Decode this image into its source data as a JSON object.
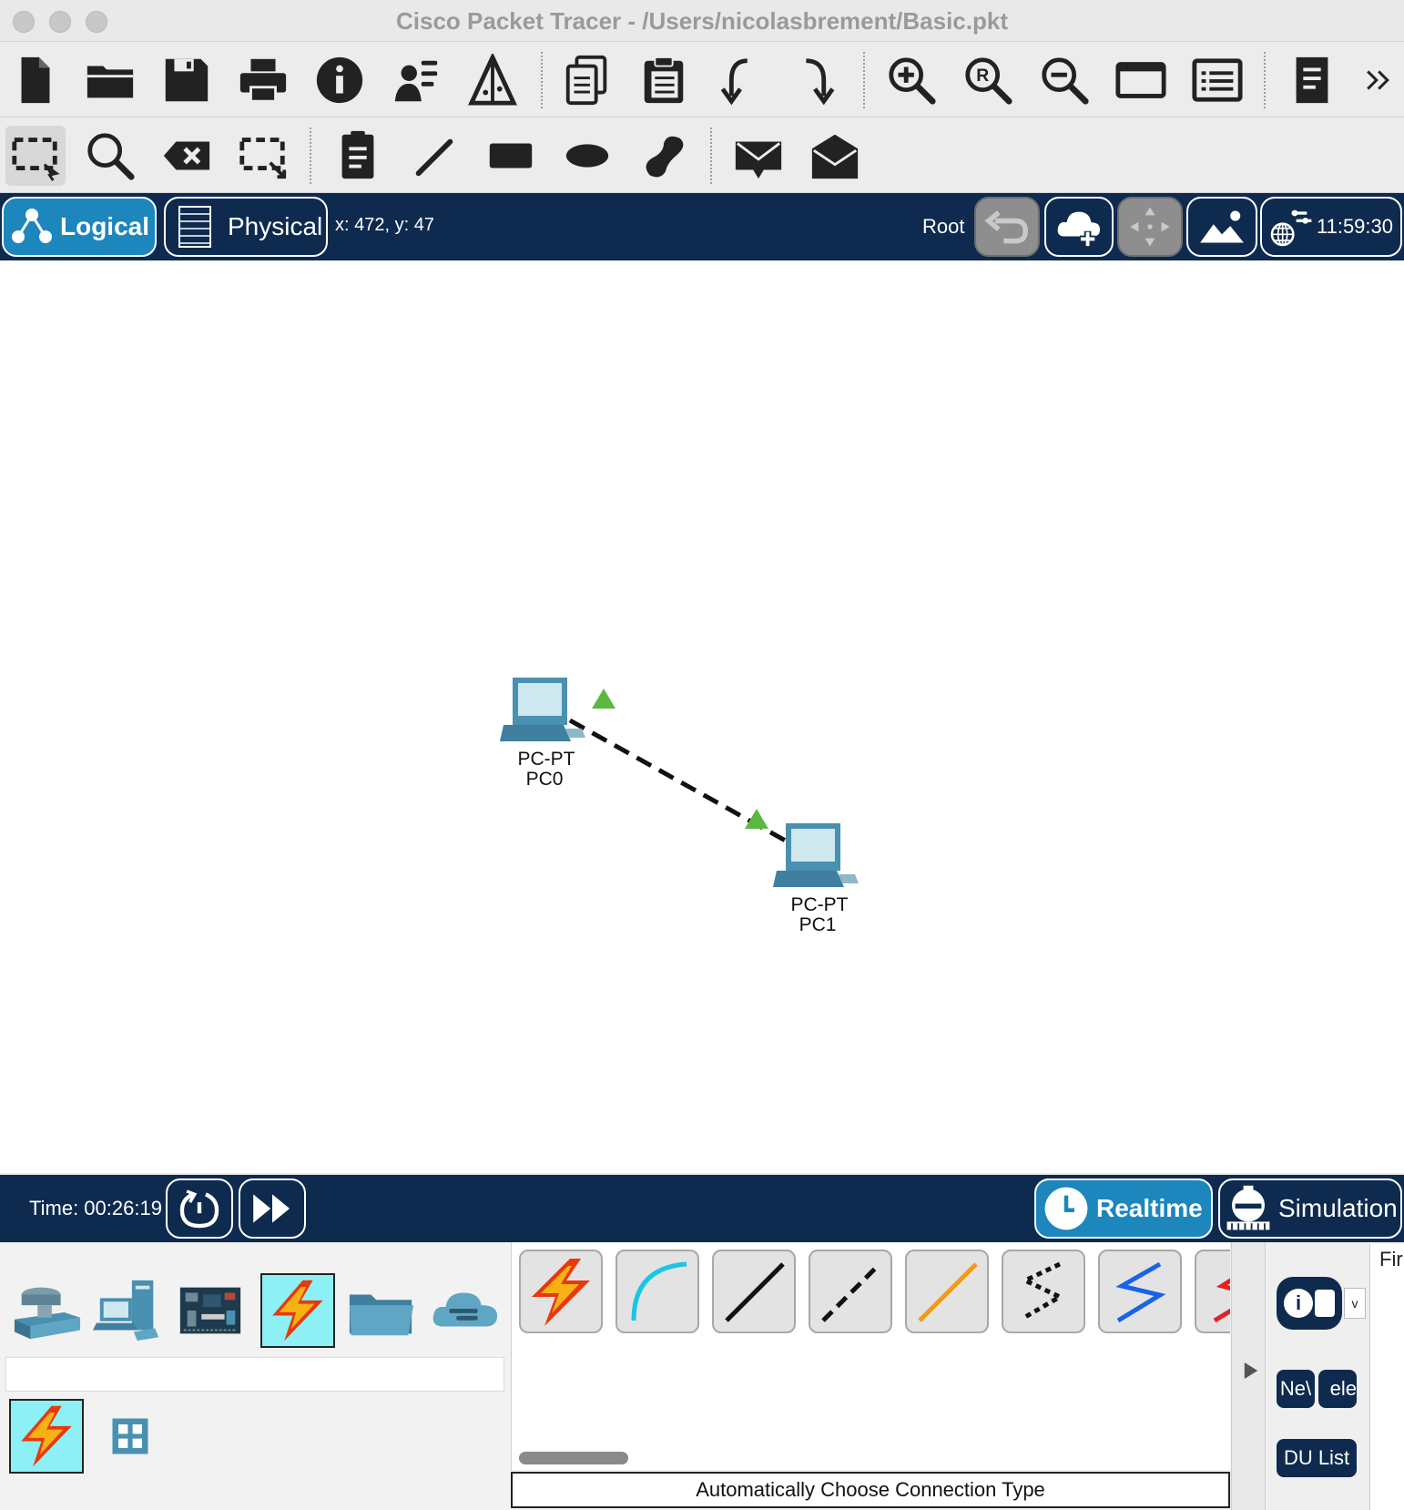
{
  "window": {
    "title": "Cisco Packet Tracer - /Users/nicolasbrement/Basic.pkt"
  },
  "main_toolbar": {
    "items": [
      "new-file",
      "open-folder",
      "save",
      "print",
      "info",
      "activity-wizard",
      "custom-device",
      "copy",
      "paste",
      "undo",
      "redo",
      "zoom-in",
      "zoom-reset",
      "zoom-out",
      "palette-window",
      "custom-devices-dialog",
      "pdu-list-doc",
      "more"
    ]
  },
  "edit_toolbar": {
    "items": [
      "select",
      "inspect",
      "delete",
      "resize-shape",
      "place-note",
      "draw-line",
      "draw-rectangle",
      "draw-ellipse",
      "freeform",
      "add-simple-pdu",
      "add-complex-pdu"
    ]
  },
  "navbar": {
    "logical_label": "Logical",
    "physical_label": "Physical",
    "coords": "x: 472, y: 47",
    "root_label": "Root",
    "clock": "11:59:30"
  },
  "topology": {
    "devices": [
      {
        "id": "pc0",
        "model": "PC-PT",
        "name": "PC0"
      },
      {
        "id": "pc1",
        "model": "PC-PT",
        "name": "PC1"
      }
    ],
    "link": {
      "type": "crossover",
      "from": "PC0",
      "to": "PC1",
      "status_color": "#5db842"
    }
  },
  "timebar": {
    "time": "Time: 00:26:19",
    "realtime_label": "Realtime",
    "simulation_label": "Simulation"
  },
  "device_palette": {
    "categories": [
      "network-devices",
      "end-devices",
      "components",
      "connections",
      "miscellaneous",
      "multiuser"
    ],
    "selected": "connections",
    "subcategories": [
      "connections",
      "structured-cabling"
    ]
  },
  "connections": {
    "types": [
      "automatic",
      "console",
      "copper-straight-through",
      "copper-cross-over",
      "fiber",
      "phone",
      "coaxial",
      "serial-dce"
    ],
    "status_text": "Automatically Choose Connection Type"
  },
  "right_panel": {
    "pdu_info_label": "i",
    "dropdown_label": "v",
    "new_label": "Ne\\",
    "delete_label": "ele",
    "pdu_list_label": "DU List",
    "fire_label": "Fir"
  },
  "colors": {
    "navy": "#0e2a4f",
    "accent": "#1c86bd",
    "icon_dark": "#222222",
    "link_green": "#5db842",
    "device_blue": "#4a90b0"
  }
}
